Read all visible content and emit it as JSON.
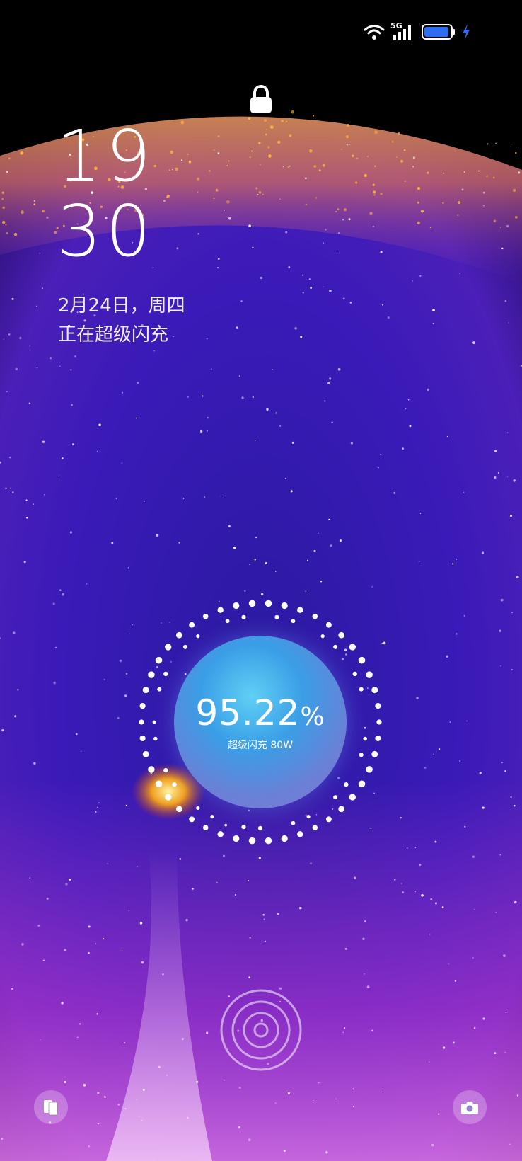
{
  "status_bar": {
    "network_label": "5G",
    "icons": [
      "wifi-icon",
      "signal-icon",
      "battery-icon",
      "charging-bolt-icon"
    ],
    "battery_level": 0.95
  },
  "lock_screen": {
    "hour": "19",
    "minute": "30",
    "date": "2月24日，周四",
    "status": "正在超级闪充"
  },
  "charging": {
    "percent_value": "95.22",
    "percent_sign": "%",
    "mode": "超级闪充 80W"
  },
  "bottom": {
    "left_icon": "wallet-icon",
    "center_icon": "fingerprint-icon",
    "right_icon": "camera-icon"
  },
  "colors": {
    "accent_blue": "#3a9ee6",
    "wallpaper_purple": "#3a1aa8",
    "wallpaper_orange": "#e89a28",
    "wallpaper_magenta": "#c83ad0"
  }
}
